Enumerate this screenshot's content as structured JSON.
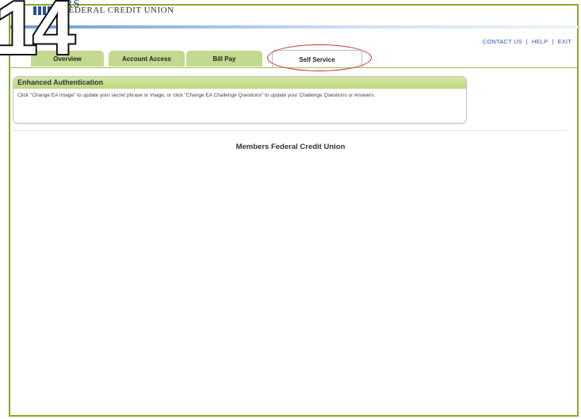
{
  "logo": {
    "name_top": "RS",
    "name_sub": "FEDERAL CREDIT UNION"
  },
  "top_links": {
    "contact": "CONTACT US",
    "help": "HELP",
    "exit": "EXIT",
    "separator": "|"
  },
  "tabs": [
    {
      "label": "Overview"
    },
    {
      "label": "Account Access"
    },
    {
      "label": "Bill Pay"
    },
    {
      "label": "Self Service",
      "active": true
    }
  ],
  "panel": {
    "title": "Enhanced Authentication",
    "body": "Click \"Change EA Image\" to update your secret phrase or image, or click \"Change EA Challenge Questions\" to update your Challenge Questions or Answers."
  },
  "footer": {
    "title": "Members Federal Credit Union"
  },
  "step_badge": {
    "number": "14"
  },
  "colors": {
    "frame_border": "#84ac27",
    "tab_green": "#c3d98f",
    "highlight": "#c9282d",
    "link_blue": "#3355aa"
  }
}
